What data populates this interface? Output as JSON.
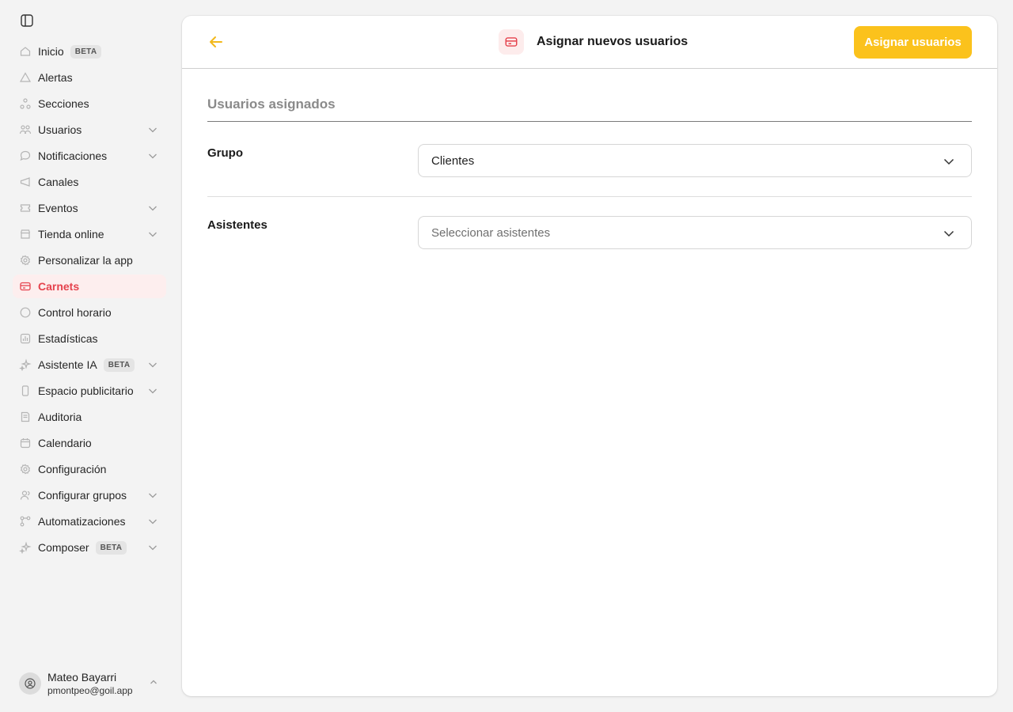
{
  "sidebar": {
    "items": [
      {
        "label": "Inicio",
        "badge": "BETA",
        "icon": "home-icon"
      },
      {
        "label": "Alertas",
        "icon": "alert-icon"
      },
      {
        "label": "Secciones",
        "icon": "sections-icon"
      },
      {
        "label": "Usuarios",
        "icon": "users-icon",
        "expandable": true
      },
      {
        "label": "Notificaciones",
        "icon": "chat-bubble-icon",
        "expandable": true
      },
      {
        "label": "Canales",
        "icon": "megaphone-icon"
      },
      {
        "label": "Eventos",
        "icon": "ticket-icon",
        "expandable": true
      },
      {
        "label": "Tienda online",
        "icon": "store-icon",
        "expandable": true
      },
      {
        "label": "Personalizar la app",
        "icon": "gear-icon"
      },
      {
        "label": "Carnets",
        "icon": "card-icon",
        "active": true
      },
      {
        "label": "Control horario",
        "icon": "clock-icon"
      },
      {
        "label": "Estadísticas",
        "icon": "chart-icon"
      },
      {
        "label": "Asistente IA",
        "badge": "BETA",
        "icon": "sparkle-icon",
        "expandable": true
      },
      {
        "label": "Espacio publicitario",
        "icon": "phone-icon",
        "expandable": true
      },
      {
        "label": "Auditoria",
        "icon": "audit-icon"
      },
      {
        "label": "Calendario",
        "icon": "calendar-icon"
      },
      {
        "label": "Configuración",
        "icon": "settings-icon"
      },
      {
        "label": "Configurar grupos",
        "icon": "user-group-icon",
        "expandable": true
      },
      {
        "label": "Automatizaciones",
        "icon": "automation-icon",
        "expandable": true
      },
      {
        "label": "Composer",
        "badge": "BETA",
        "icon": "sparkle-icon",
        "expandable": true
      }
    ]
  },
  "user": {
    "name": "Mateo Bayarri",
    "email": "pmontpeo@goil.app"
  },
  "header": {
    "title": "Asignar nuevos usuarios",
    "primary_button": "Asignar usuarios"
  },
  "form": {
    "section_title": "Usuarios asignados",
    "group": {
      "label": "Grupo",
      "value": "Clientes"
    },
    "attendees": {
      "label": "Asistentes",
      "placeholder": "Seleccionar asistentes"
    }
  },
  "colors": {
    "accent": "#fbc21c",
    "active": "#e5424d",
    "active_bg": "#fdeeee"
  }
}
